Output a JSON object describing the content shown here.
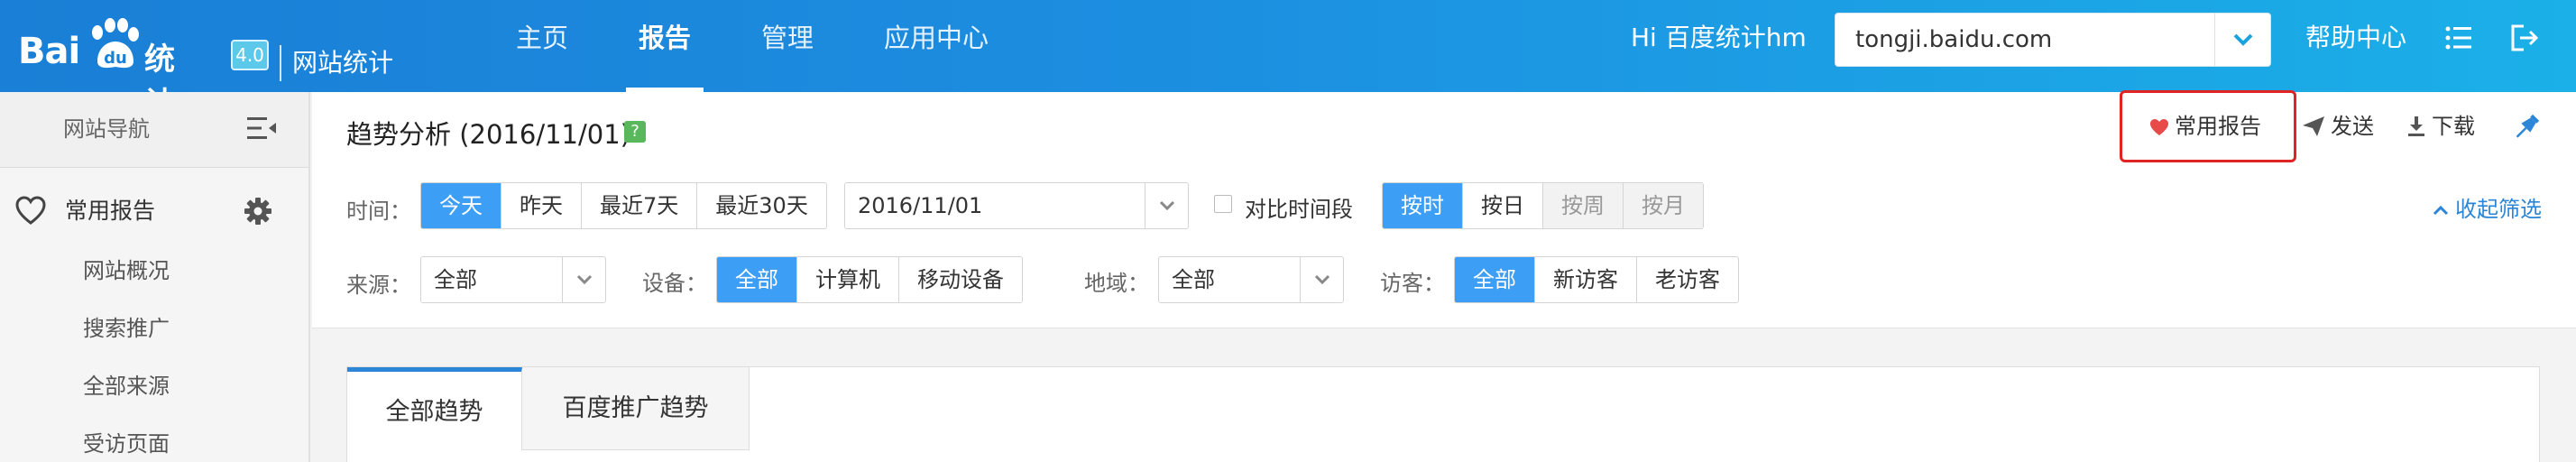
{
  "logo": {
    "brand": "Bai",
    "brand_suffix": "统计",
    "version": "4.0",
    "site_label": "网站统计"
  },
  "nav": [
    {
      "label": "主页"
    },
    {
      "label": "报告"
    },
    {
      "label": "管理"
    },
    {
      "label": "应用中心"
    }
  ],
  "user": {
    "greeting": "Hi 百度统计hm"
  },
  "site_select": {
    "value": "tongji.baidu.com"
  },
  "help": {
    "label": "帮助中心"
  },
  "sidebar": {
    "title": "网站导航",
    "favorites_label": "常用报告",
    "items": [
      "网站概况",
      "搜索推广",
      "全部来源",
      "受访页面"
    ]
  },
  "page": {
    "title": "趋势分析 (2016/11/01)",
    "help_mark": "?"
  },
  "actions": {
    "favorite": "常用报告",
    "send": "发送",
    "download": "下载"
  },
  "filters": {
    "time_label": "时间：",
    "time_options": [
      "今天",
      "昨天",
      "最近7天",
      "最近30天"
    ],
    "date_value": "2016/11/01",
    "compare_label": "对比时间段",
    "granularity": [
      "按时",
      "按日",
      "按周",
      "按月"
    ],
    "collapse_label": "收起筛选",
    "source_label": "来源：",
    "source_value": "全部",
    "device_label": "设备：",
    "device_options": [
      "全部",
      "计算机",
      "移动设备"
    ],
    "region_label": "地域：",
    "region_value": "全部",
    "visitor_label": "访客：",
    "visitor_options": [
      "全部",
      "新访客",
      "老访客"
    ]
  },
  "tabs": [
    "全部趋势",
    "百度推广趋势"
  ],
  "colors": {
    "accent": "#3d9ef5",
    "highlight_border": "#e02424",
    "link": "#2b86d8"
  }
}
